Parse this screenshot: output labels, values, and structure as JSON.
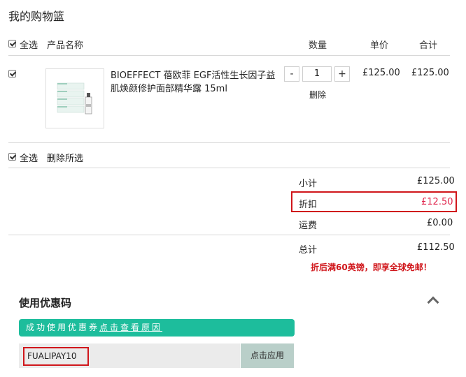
{
  "page": {
    "title": "我的购物篮"
  },
  "header": {
    "select_all": "全选",
    "product_name": "产品名称",
    "quantity": "数量",
    "unit_price": "单价",
    "total": "合计"
  },
  "item": {
    "name_line1": "BIOEFFECT 蓓欧菲 EGF活性生长因子益",
    "name_line2": "肌焕颜修护面部精华露 15ml",
    "quantity": "1",
    "minus": "-",
    "plus": "+",
    "delete": "删除",
    "unit_price": "£125.00",
    "total": "£125.00"
  },
  "footer_actions": {
    "select_all": "全选",
    "delete_selected": "删除所选"
  },
  "summary": {
    "subtotal_label": "小计",
    "subtotal": "£125.00",
    "discount_label": "折扣",
    "discount": "£12.50",
    "shipping_label": "运费",
    "shipping": "£0.00",
    "grand_total_label": "总计",
    "grand_total": "£112.50",
    "free_shipping_note": "折后满60英镑，即享全球免邮！"
  },
  "coupon": {
    "section_title": "使用优惠码",
    "success_text": "成功使用优惠券",
    "success_link": "点击查看原因",
    "code_value": "FUALIPAY10",
    "apply_label": "点击应用"
  },
  "colors": {
    "accent_green": "#1dbd9c",
    "highlight_red": "#d0161b",
    "discount_red": "#e0234b"
  }
}
